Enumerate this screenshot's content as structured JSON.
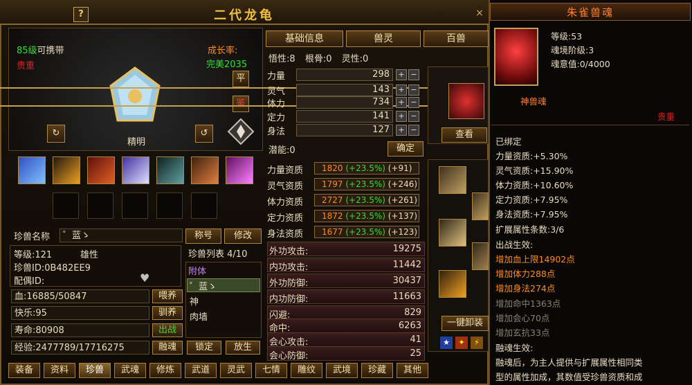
{
  "window": {
    "title": "二代龙龟",
    "help": "?",
    "close": "×"
  },
  "pet": {
    "level_carry": "85级可携带",
    "level_prefix": "85级",
    "carry": "可携带",
    "rarity": "贵重",
    "growth_label": "成长率:",
    "growth_value": "完美2035",
    "personality": "精明",
    "btn_ping": "平",
    "btn_jian": "鉴"
  },
  "tabs_top": {
    "basic": "基础信息",
    "spirit": "兽灵",
    "hundred": "百兽"
  },
  "attrs": {
    "wuxing_label": "悟性:",
    "wuxing": "8",
    "gengu_label": "根骨:",
    "gengu": "0",
    "lingxing_label": "灵性:",
    "lingxing": "0"
  },
  "stats": [
    {
      "label": "力量",
      "value": "298"
    },
    {
      "label": "灵气",
      "value": "143"
    },
    {
      "label": "体力",
      "value": "734"
    },
    {
      "label": "定力",
      "value": "141"
    },
    {
      "label": "身法",
      "value": "127"
    }
  ],
  "potential": {
    "label": "潜能:",
    "value": "0",
    "confirm": "确定"
  },
  "aptitudes": [
    {
      "label": "力量资质",
      "base": "1820",
      "pct": "(+23.5%)",
      "add": "(+91)"
    },
    {
      "label": "灵气资质",
      "base": "1797",
      "pct": "(+23.5%)",
      "add": "(+246)"
    },
    {
      "label": "体力资质",
      "base": "2727",
      "pct": "(+23.5%)",
      "add": "(+261)"
    },
    {
      "label": "定力资质",
      "base": "1872",
      "pct": "(+23.5%)",
      "add": "(+137)"
    },
    {
      "label": "身法资质",
      "base": "1677",
      "pct": "(+23.5%)",
      "add": "(+123)"
    }
  ],
  "combat": [
    {
      "label": "外功攻击:",
      "value": "19275"
    },
    {
      "label": "内功攻击:",
      "value": "11442"
    },
    {
      "label": "外功防御:",
      "value": "30437"
    },
    {
      "label": "内功防御:",
      "value": "11663"
    },
    {
      "label": "闪避:",
      "value": "829"
    },
    {
      "label": "命中:",
      "value": "6263"
    },
    {
      "label": "会心攻击:",
      "value": "41"
    },
    {
      "label": "会心防御:",
      "value": "25"
    }
  ],
  "info": {
    "name_label": "珍兽名称",
    "name_value": "゜蓝ゝ",
    "btn_title": "称号",
    "btn_rename": "修改",
    "level": "等级:121",
    "gender": "雄性",
    "id": "珍兽ID:0B482EE9",
    "mate": "配偶ID:",
    "list_label": "珍兽列表",
    "list_count": "4/10",
    "hp": "血:16885/50847",
    "btn_feed": "喂养",
    "happy": "快乐:95",
    "btn_tame": "驯养",
    "life": "寿命:80908",
    "btn_battle": "出战",
    "exp": "经验:2477789/17716275",
    "btn_fuse": "融魂",
    "btn_lock": "锁定",
    "btn_release": "放生"
  },
  "pet_list": [
    {
      "name": "附体"
    },
    {
      "name": "゜蓝ゝ"
    },
    {
      "name": "神"
    },
    {
      "name": "肉墙"
    }
  ],
  "side": {
    "view": "查看",
    "unequip": "一键卸装"
  },
  "bottom_tabs": [
    "装备",
    "资料",
    "珍兽",
    "武魂",
    "修炼",
    "武道",
    "灵武",
    "七情",
    "雕纹",
    "武境",
    "珍藏",
    "其他"
  ],
  "soul": {
    "title": "朱雀兽魂",
    "level": "等级:53",
    "stage": "魂境阶级:3",
    "will": "魂意值:0/4000",
    "type": "神兽魂",
    "rarity": "贵重",
    "bound": "已绑定",
    "apt_lines": [
      "力量资质:+5.30%",
      "灵气资质:+15.90%",
      "体力资质:+10.60%",
      "定力资质:+7.95%",
      "身法资质:+7.95%",
      "扩展属性条数:3/6"
    ],
    "battle_label": "出战生效:",
    "battle_active": [
      "增加血上限14902点",
      "增加体力288点",
      "增加身法274点"
    ],
    "battle_inactive": [
      "增加命中1363点",
      "增加会心70点",
      "增加玄抗33点"
    ],
    "fuse_label": "融魂生效:",
    "fuse_text1": "融魂后，为主人提供与扩展属性相同类",
    "fuse_text2": "型的属性加成，其数值受珍兽资质和成"
  },
  "colors": {
    "accent": "#f0c040",
    "red": "#e02020",
    "green": "#30e030",
    "orange": "#ff8c20"
  }
}
